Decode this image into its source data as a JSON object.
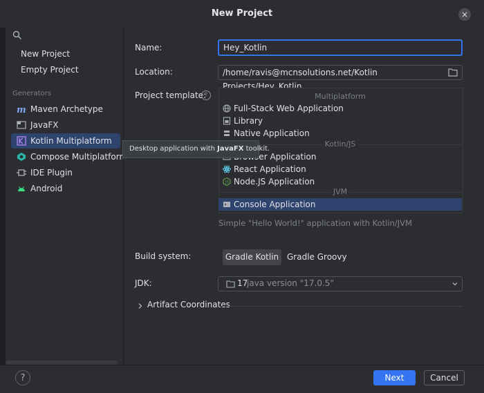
{
  "window": {
    "title": "New Project",
    "close_glyph": "×"
  },
  "sidebar": {
    "search_icon": "search-icon",
    "top_items": [
      {
        "label": "New Project"
      },
      {
        "label": "Empty Project"
      }
    ],
    "section_label": "Generators",
    "generators": [
      {
        "label": "Maven Archetype",
        "icon": "maven-icon"
      },
      {
        "label": "JavaFX",
        "icon": "javafx-icon"
      },
      {
        "label": "Kotlin Multiplatform",
        "icon": "kotlin-icon",
        "selected": true
      },
      {
        "label": "Compose Multiplatform",
        "icon": "compose-icon"
      },
      {
        "label": "IDE Plugin",
        "icon": "plugin-icon"
      },
      {
        "label": "Android",
        "icon": "android-icon"
      }
    ]
  },
  "form": {
    "name_label": "Name:",
    "name_value": "Hey_Kotlin",
    "location_label": "Location:",
    "location_value": "/home/ravis@mcnsolutions.net/Kotlin Projects/Hey_Kotlin",
    "template_label": "Project template:",
    "template_help_glyph": "?",
    "groups": [
      {
        "title": "Multiplatform",
        "items": [
          "Full-Stack Web Application",
          "Library",
          "Native Application"
        ]
      },
      {
        "title": "Kotlin/JS",
        "items": [
          "Browser Application",
          "React Application",
          "Node.JS Application"
        ]
      },
      {
        "title": "JVM",
        "items": [
          "Console Application"
        ]
      }
    ],
    "selected_template": "Console Application",
    "template_description": "Simple \"Hello World!\" application with Kotlin/JVM",
    "build_label": "Build system:",
    "build_options": [
      "Gradle Kotlin",
      "Gradle Groovy"
    ],
    "build_selected": "Gradle Kotlin",
    "jdk_label": "JDK:",
    "jdk_version": "17",
    "jdk_detail": "java version \"17.0.5\"",
    "artifact_label": "Artifact Coordinates"
  },
  "tooltip": {
    "prefix": "Desktop application with ",
    "bold": "JavaFX",
    "suffix": " toolkit."
  },
  "footer": {
    "help_glyph": "?",
    "next_label": "Next",
    "cancel_label": "Cancel"
  },
  "colors": {
    "accent": "#3574f0",
    "selection": "#2e436e",
    "background": "#2b2d30"
  }
}
